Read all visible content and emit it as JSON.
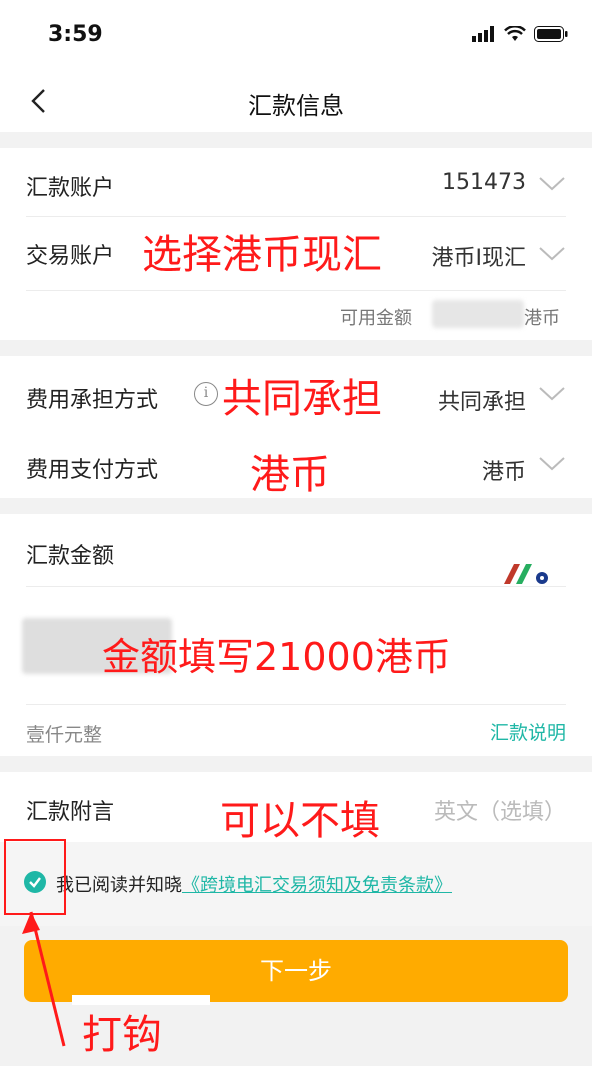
{
  "status": {
    "time": "3:59"
  },
  "nav": {
    "title": "汇款信息"
  },
  "remit_account": {
    "label": "汇款账户",
    "value": "151473"
  },
  "trade_account": {
    "label": "交易账户",
    "value": "港币I现汇",
    "available_label": "可用金额",
    "available_unit": "港币"
  },
  "fee_bearer": {
    "label": "费用承担方式",
    "value": "共同承担"
  },
  "fee_payment": {
    "label": "费用支付方式",
    "value": "港币"
  },
  "amount": {
    "label": "汇款金额",
    "words": "壹仟元整",
    "help_link": "汇款说明"
  },
  "postscript": {
    "label": "汇款附言",
    "placeholder_visible": "英文（选填）"
  },
  "agreement": {
    "prefix": "我已阅读并知晓",
    "link": "《跨境电汇交易须知及免责条款》",
    "checked": true
  },
  "next_button": "下一步",
  "annotations": {
    "select_hkd": "选择港币现汇",
    "shared": "共同承担",
    "hkd": "港币",
    "amount_fill": "金额填写21000港币",
    "optional": "可以不填",
    "tick": "打钩"
  },
  "colors": {
    "accent": "#1fb7a6",
    "button": "#ffab00",
    "annotation": "#ff1a1a"
  }
}
